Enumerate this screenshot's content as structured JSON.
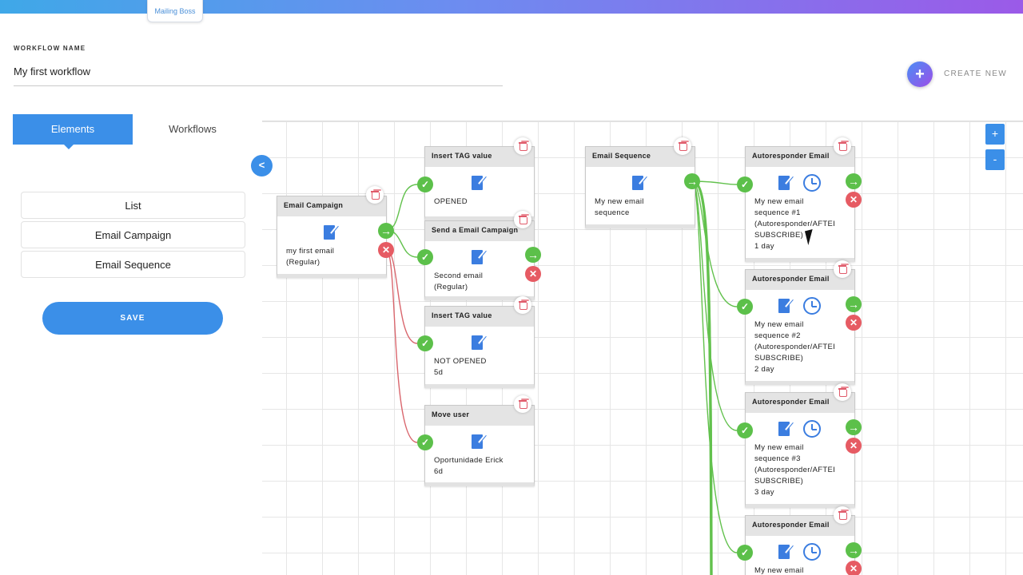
{
  "brand": {
    "logo_text": "Mailing Boss"
  },
  "workflow": {
    "label": "WORKFLOW NAME",
    "name": "My first workflow"
  },
  "header": {
    "create_label": "CREATE NEW",
    "create_icon": "+"
  },
  "sidebar": {
    "tabs": [
      {
        "label": "Elements",
        "active": true
      },
      {
        "label": "Workflows",
        "active": false
      }
    ],
    "elements": [
      {
        "label": "List"
      },
      {
        "label": "Email Campaign"
      },
      {
        "label": "Email Sequence"
      }
    ],
    "save_label": "SAVE",
    "collapse_label": "<"
  },
  "zoom": {
    "plus": "+",
    "minus": "-"
  },
  "colors": {
    "accent": "#3b8fe8",
    "success": "#5cc04a",
    "danger": "#e65b63",
    "wire_green": "#62c14d",
    "wire_red": "#d9666d"
  },
  "nodes": [
    {
      "title": "Email Campaign",
      "text": "my first email\n(Regular)"
    },
    {
      "title": "Insert TAG value",
      "text": "OPENED"
    },
    {
      "title": "Send a Email Campaign",
      "text": "Second email\n(Regular)"
    },
    {
      "title": "Insert TAG value",
      "text": "NOT OPENED\n5d"
    },
    {
      "title": "Move user",
      "text": "Oportunidade Erick\n6d"
    },
    {
      "title": "Email Sequence",
      "text": "My new email\nsequence"
    },
    {
      "title": "Autoresponder Email",
      "text": "My new email\nsequence #1\n(Autoresponder/AFTEI\nSUBSCRIBE)\n1 day"
    },
    {
      "title": "Autoresponder Email",
      "text": "My new email\nsequence #2\n(Autoresponder/AFTEI\nSUBSCRIBE)\n2 day"
    },
    {
      "title": "Autoresponder Email",
      "text": "My new email\nsequence #3\n(Autoresponder/AFTEI\nSUBSCRIBE)\n3 day"
    },
    {
      "title": "Autoresponder Email",
      "text": "My new email"
    }
  ]
}
